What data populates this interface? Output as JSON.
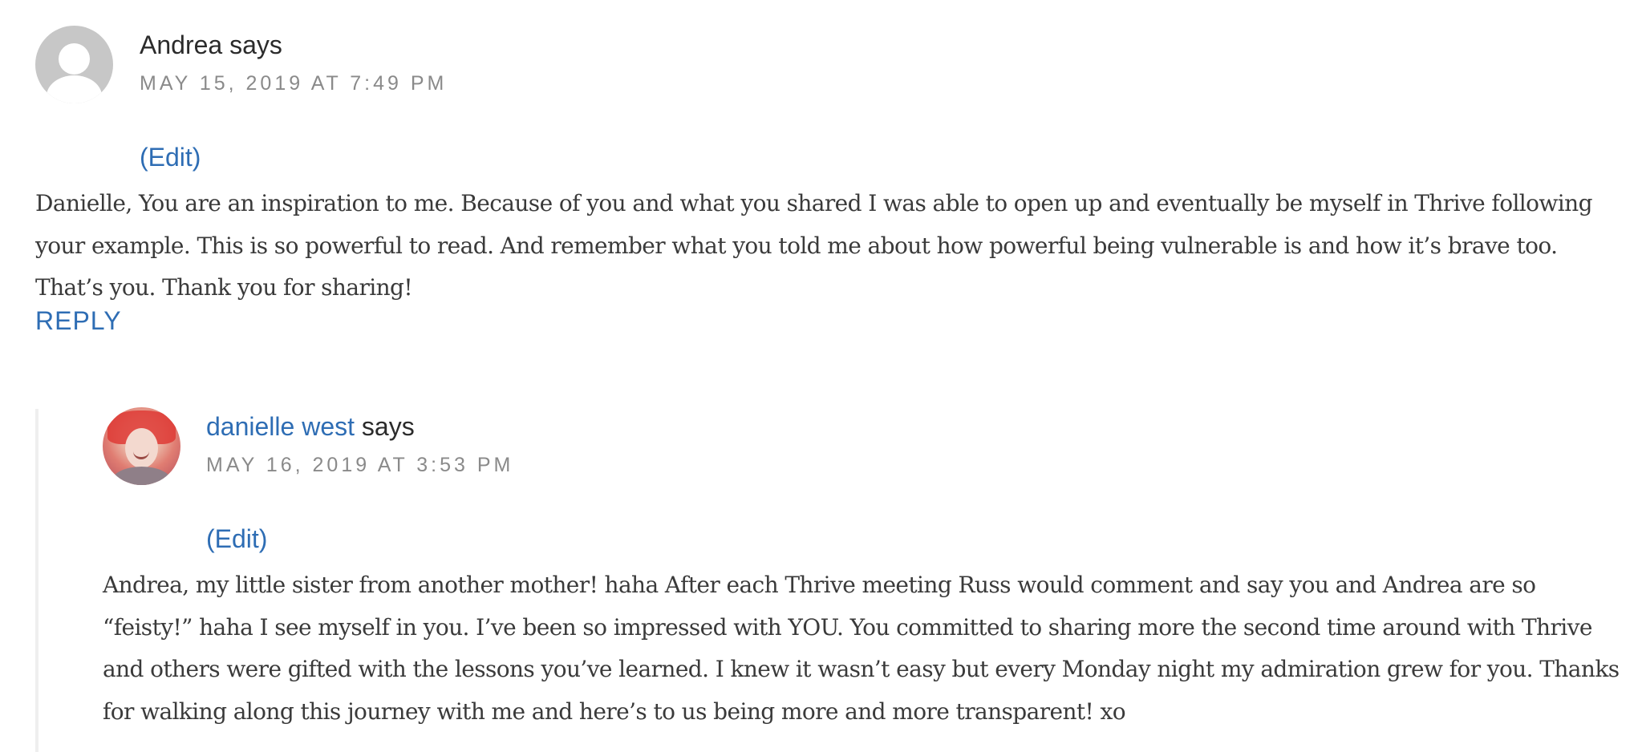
{
  "comments": [
    {
      "author": "Andrea",
      "says": "says",
      "date": "MAY 15, 2019 AT 7:49 PM",
      "edit": "(Edit)",
      "body": "Danielle, You are an inspiration to me. Because of you and what you shared I was able to open up and eventually be myself in Thrive following your example. This is so powerful to read. And remember what you told me about how powerful being vulnerable is and how it’s brave too. That’s you. Thank you for sharing!",
      "reply": "REPLY"
    },
    {
      "author": "danielle west",
      "says": "says",
      "date": "MAY 16, 2019 AT 3:53 PM",
      "edit": "(Edit)",
      "body": "Andrea, my little sister from another mother! haha After each Thrive meeting Russ would comment and say you and Andrea are so “feisty!” haha I see myself in you. I’ve been so impressed with YOU. You committed to sharing more the second time around with Thrive and others were gifted with the lessons you’ve learned. I knew it wasn’t easy but every Monday night my admiration grew for you. Thanks for walking along this journey with me and here’s to us being more and more transparent! xo"
    }
  ],
  "icons": {
    "comment_1_avatar": "default-user-avatar-icon",
    "comment_2_avatar": "user-photo-avatar"
  },
  "colors": {
    "link": "#2e6db4",
    "date": "#8a8a8a",
    "body": "#3a3a3a",
    "thread_line": "#efefef"
  }
}
